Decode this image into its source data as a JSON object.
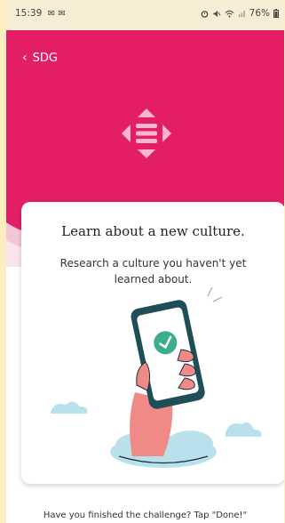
{
  "status_bar": {
    "time": "15:39",
    "notification_icons": [
      "mail-icon",
      "mail-icon"
    ],
    "battery": "76%"
  },
  "header": {
    "back_label": "SDG",
    "accent_color": "#e41e66"
  },
  "card": {
    "title": "Learn about a new culture.",
    "description": "Research a culture you haven't yet learned about."
  },
  "footer": {
    "text": "Have you finished the challenge? Tap \"Done!\""
  }
}
